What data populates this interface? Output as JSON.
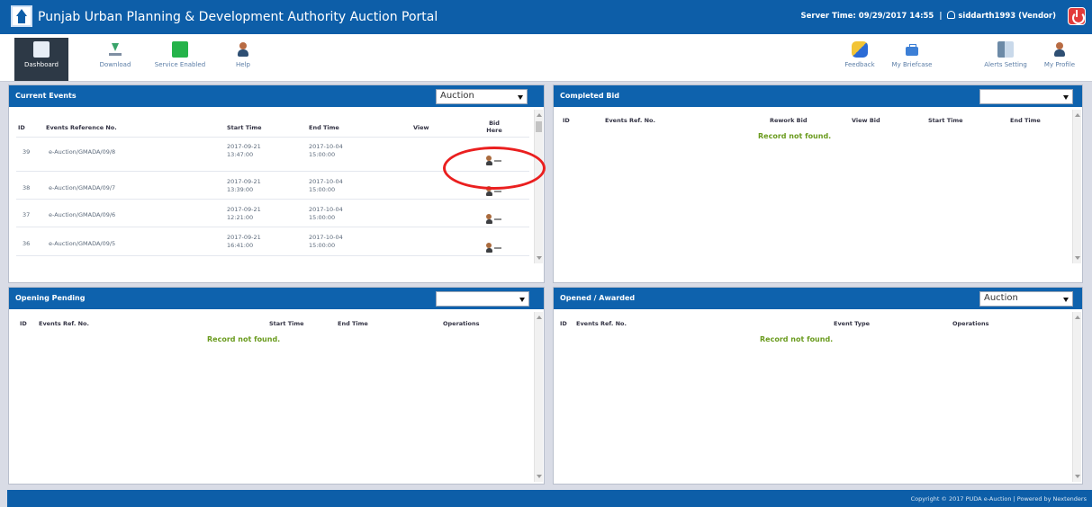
{
  "header": {
    "title": "Punjab Urban Planning & Development Authority Auction Portal",
    "server_label": "Server Time:",
    "server_time": "09/29/2017 14:55",
    "username": "siddarth1993",
    "role": "(Vendor)"
  },
  "toolbar": {
    "left": [
      {
        "label": "Dashboard",
        "icon": "dashboard-icon"
      },
      {
        "label": "Download",
        "icon": "download-icon"
      },
      {
        "label": "Service Enabled",
        "icon": "service-icon"
      },
      {
        "label": "Help",
        "icon": "help-icon"
      }
    ],
    "right": [
      {
        "label": "Feedback",
        "icon": "feedback-icon"
      },
      {
        "label": "My Briefcase",
        "icon": "briefcase-icon"
      },
      {
        "label": "Alerts Setting",
        "icon": "alerts-icon"
      },
      {
        "label": "My Profile",
        "icon": "profile-icon"
      }
    ]
  },
  "current_events": {
    "title": "Current Events",
    "select": "Auction",
    "columns": [
      "ID",
      "Events Reference No.",
      "Start Time",
      "End Time",
      "View",
      "Bid Here"
    ],
    "rows": [
      {
        "id": "39",
        "ref": "e-Auction/GMADA/09/8",
        "start": "2017-09-21 13:47:00",
        "end": "2017-10-04 15:00:00"
      },
      {
        "id": "38",
        "ref": "e-Auction/GMADA/09/7",
        "start": "2017-09-21 13:39:00",
        "end": "2017-10-04 15:00:00"
      },
      {
        "id": "37",
        "ref": "e-Auction/GMADA/09/6",
        "start": "2017-09-21 12:21:00",
        "end": "2017-10-04 15:00:00"
      },
      {
        "id": "36",
        "ref": "e-Auction/GMADA/09/5",
        "start": "2017-09-21 16:41:00",
        "end": "2017-10-04 15:00:00"
      }
    ]
  },
  "completed_bid": {
    "title": "Completed Bid",
    "select": "",
    "columns": [
      "ID",
      "Events Ref. No.",
      "Rework Bid",
      "View Bid",
      "Start Time",
      "End Time"
    ],
    "empty": "Record not found."
  },
  "opening_pending": {
    "title": "Opening Pending",
    "select": "",
    "columns": [
      "ID",
      "Events Ref. No.",
      "Start Time",
      "End Time",
      "Operations"
    ],
    "empty": "Record not found."
  },
  "opened_awarded": {
    "title": "Opened / Awarded",
    "select": "Auction",
    "columns": [
      "ID",
      "Events Ref. No.",
      "Event Type",
      "Operations"
    ],
    "empty": "Record not found."
  },
  "footer": {
    "text": "Copyright © 2017 PUDA e-Auction | Powered by Nextenders"
  },
  "colors": {
    "header_blue": "#0d5ea8",
    "panel_blue": "#0e62ad",
    "no_record_green": "#6a9b1e",
    "annotation_red": "#ea1f1f"
  }
}
